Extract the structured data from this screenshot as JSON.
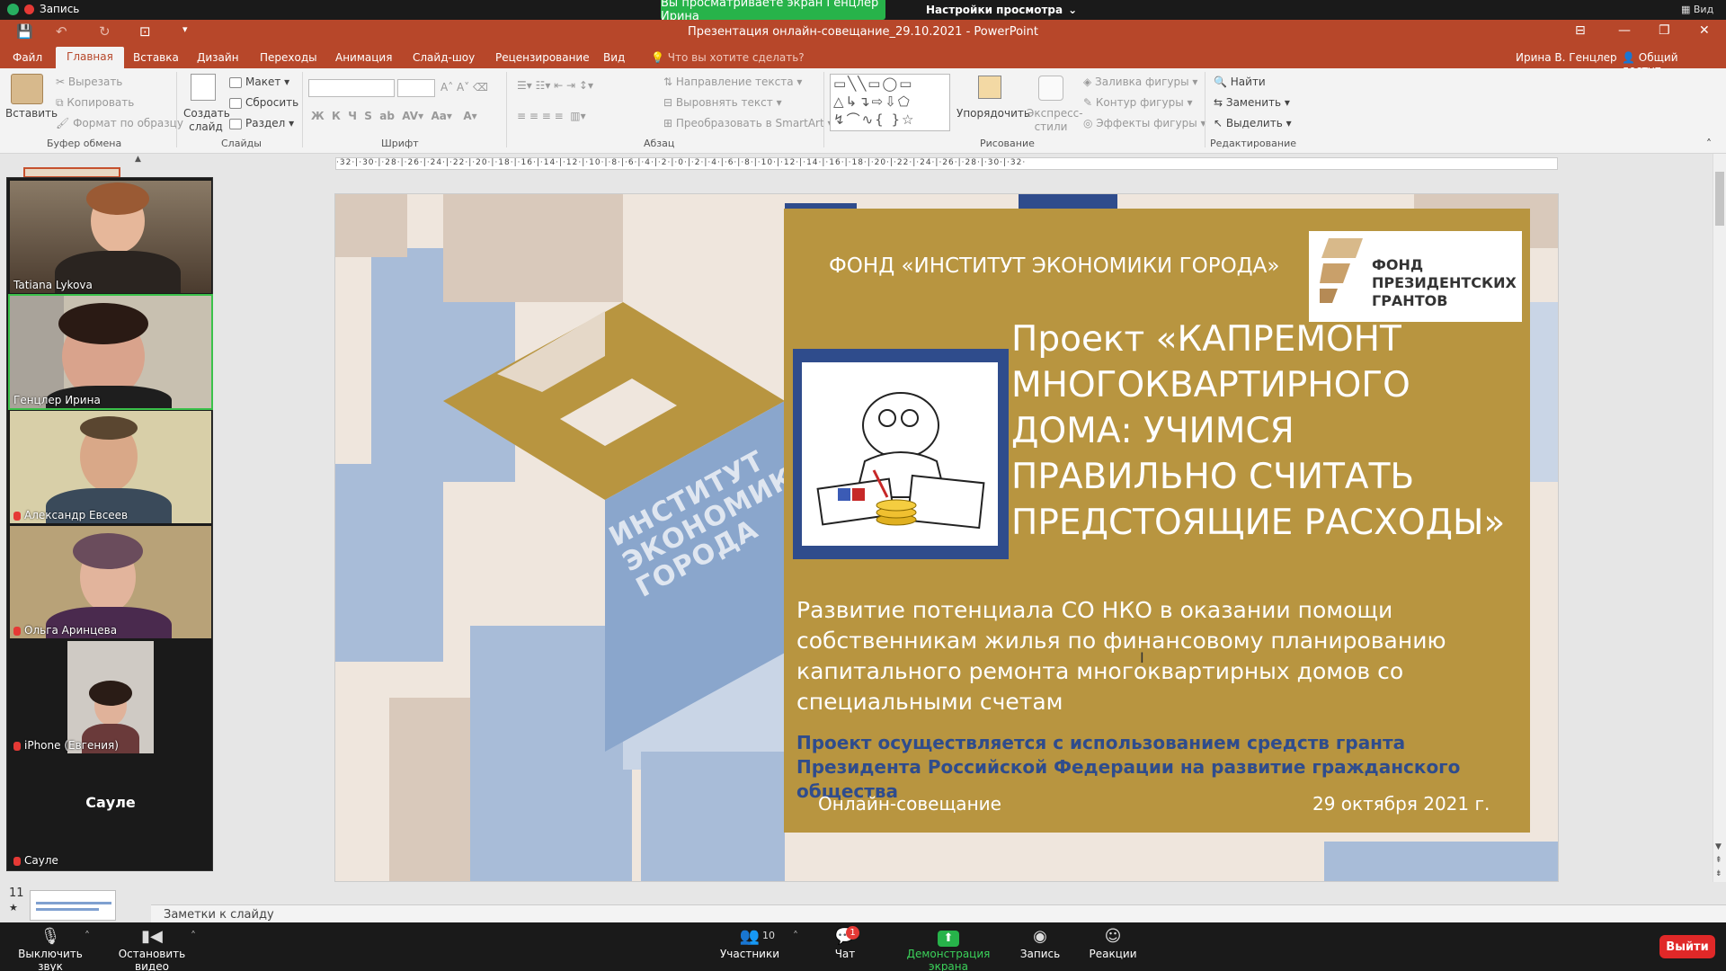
{
  "zoom": {
    "record_label": "Запись",
    "share_banner": "Вы просматриваете экран Генцлер Ирина",
    "view_options": "Настройки просмотра",
    "view_label": "Вид"
  },
  "ppt": {
    "window_title": "Презентация онлайн-совещание_29.10.2021 - PowerPoint",
    "user": "Ирина В. Генцлер",
    "share": "Общий доступ",
    "tabs": [
      "Файл",
      "Главная",
      "Вставка",
      "Дизайн",
      "Переходы",
      "Анимация",
      "Слайд-шоу",
      "Рецензирование",
      "Вид"
    ],
    "tell_me": "Что вы хотите сделать?",
    "clipboard": {
      "paste": "Вставить",
      "cut": "Вырезать",
      "copy": "Копировать",
      "format": "Формат по образцу",
      "label": "Буфер обмена"
    },
    "slides": {
      "new": "Создать слайд",
      "layout": "Макет",
      "reset": "Сбросить",
      "section": "Раздел",
      "label": "Слайды"
    },
    "font_label": "Шрифт",
    "paragraph": {
      "direction": "Направление текста",
      "align": "Выровнять текст",
      "smartart": "Преобразовать в SmartArt",
      "label": "Абзац"
    },
    "drawing": {
      "arrange": "Упорядочить",
      "styles": "Экспресс-стили",
      "fill": "Заливка фигуры",
      "outline": "Контур фигуры",
      "effects": "Эффекты фигуры",
      "label": "Рисование"
    },
    "editing": {
      "find": "Найти",
      "replace": "Заменить",
      "select": "Выделить",
      "label": "Редактирование"
    },
    "notes": "Заметки к слайду",
    "thumb_number": "11",
    "ruler": "·32·|·30·|·28·|·26·|·24·|·22·|·20·|·18·|·16·|·14·|·12·|·10·|·8·|·6·|·4·|·2·|·0·|·2·|·4·|·6·|·8·|·10·|·12·|·14·|·16·|·18·|·20·|·22·|·24·|·26·|·28·|·30·|·32·"
  },
  "slide": {
    "fund": "ФОНД «ИНСТИТУТ ЭКОНОМИКИ ГОРОДА»",
    "grant_logo": "ФОНД ПРЕЗИДЕНТСКИХ ГРАНТОВ",
    "institute_logo": "ИНСТИТУТ ЭКОНОМИКИ ГОРОДА",
    "title": "Проект «КАПРЕМОНТ МНОГОКВАРТИРНОГО ДОМА: УЧИМСЯ ПРАВИЛЬНО СЧИТАТЬ ПРЕДСТОЯЩИЕ РАСХОДЫ»",
    "subtitle": "Развитие потенциала СО НКО в оказании помощи собственникам жилья по финансовому планированию капитального ремонта многоквартирных домов со специальными счетам",
    "grant_note": "Проект осуществляется с использованием средств гранта Президента Российской Федерации на развитие гражданского общества",
    "meeting": "Онлайн-совещание",
    "date": "29 октября 2021 г."
  },
  "participants": [
    {
      "name": "Tatiana Lykova",
      "muted": false
    },
    {
      "name": "Генцлер Ирина",
      "muted": false
    },
    {
      "name": "Александр Евсеев",
      "muted": true
    },
    {
      "name": "Ольга Аринцева",
      "muted": true
    },
    {
      "name": "iPhone (Евгения)",
      "muted": true
    },
    {
      "name": "Сауле",
      "muted": true,
      "avatar_text": "Сауле"
    }
  ],
  "toolbar": {
    "mute": "Выключить звук",
    "video": "Остановить видео",
    "participants": "Участники",
    "participants_count": "10",
    "chat": "Чат",
    "chat_badge": "1",
    "share": "Демонстрация экрана",
    "record": "Запись",
    "reactions": "Реакции",
    "leave": "Выйти"
  },
  "colors": {
    "ppt_accent": "#b7472a",
    "zoom_green": "#27b34a",
    "slide_gold": "#b89540",
    "slide_blue": "#2f4c8c"
  }
}
